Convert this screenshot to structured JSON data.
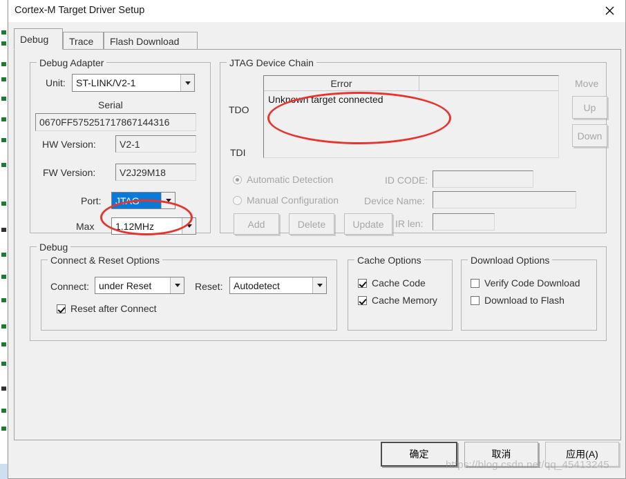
{
  "window": {
    "title": "Cortex-M Target Driver Setup",
    "close_icon": "close-icon"
  },
  "tabs": [
    {
      "label": "Debug",
      "selected": true
    },
    {
      "label": "Trace",
      "selected": false
    },
    {
      "label": "Flash Download",
      "selected": false
    }
  ],
  "debug_adapter": {
    "group_title": "Debug Adapter",
    "unit_label": "Unit:",
    "unit_value": "ST-LINK/V2-1",
    "serial_label": "Serial",
    "serial_value": "0670FF575251717867144316",
    "hw_version_label": "HW Version:",
    "hw_version_value": "V2-1",
    "fw_version_label": "FW Version:",
    "fw_version_value": "V2J29M18",
    "port_label": "Port:",
    "port_value": "JTAG",
    "max_label": "Max",
    "max_value": "1.12MHz"
  },
  "jtag_device_chain": {
    "group_title": "JTAG Device Chain",
    "tdo_label": "TDO",
    "tdi_label": "TDI",
    "columns": [
      "Error",
      ""
    ],
    "rows": [
      {
        "error": "Unknown target connected"
      }
    ],
    "move_label": "Move",
    "up_label": "Up",
    "down_label": "Down",
    "automatic_detection_label": "Automatic Detection",
    "manual_configuration_label": "Manual Configuration",
    "automatic_detection_selected": true,
    "id_code_label": "ID CODE:",
    "id_code_value": "",
    "device_name_label": "Device Name:",
    "device_name_value": "",
    "ir_len_label": "IR len:",
    "ir_len_value": "",
    "add_label": "Add",
    "delete_label": "Delete",
    "update_label": "Update"
  },
  "debug_section": {
    "group_title": "Debug",
    "connect_reset": {
      "group_title": "Connect & Reset Options",
      "connect_label": "Connect:",
      "connect_value": "under Reset",
      "reset_label": "Reset:",
      "reset_value": "Autodetect",
      "reset_after_connect_label": "Reset after Connect",
      "reset_after_connect_checked": true
    },
    "cache_options": {
      "group_title": "Cache Options",
      "cache_code_label": "Cache Code",
      "cache_code_checked": true,
      "cache_memory_label": "Cache Memory",
      "cache_memory_checked": true
    },
    "download_options": {
      "group_title": "Download Options",
      "verify_code_download_label": "Verify Code Download",
      "verify_code_download_checked": false,
      "download_to_flash_label": "Download to Flash",
      "download_to_flash_checked": false
    }
  },
  "footer": {
    "ok_label": "确定",
    "cancel_label": "取消",
    "apply_label": "应用(A)"
  },
  "watermark": "https://blog.csdn.net/qq_45413245",
  "colors": {
    "accent_selection": "#0b7ad6",
    "annotation": "#e8332e",
    "dialog_bg": "#f0f0f0",
    "disabled_text": "#a6a6a6"
  }
}
